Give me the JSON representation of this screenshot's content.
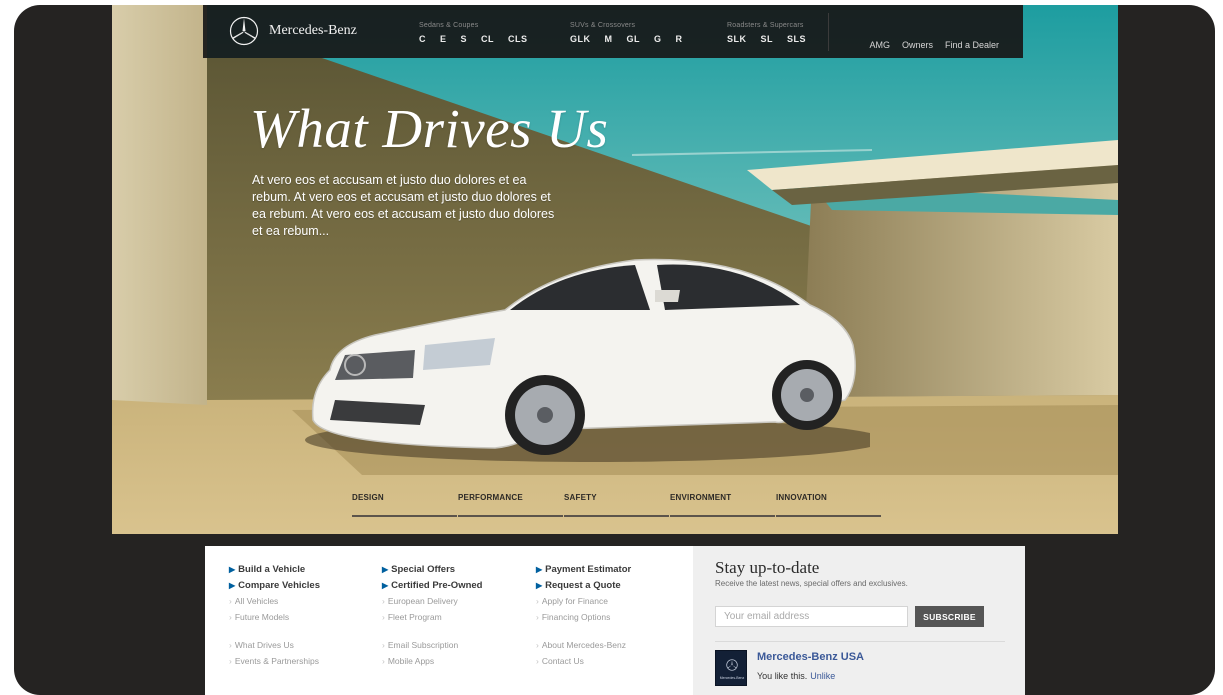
{
  "brand": {
    "name": "Mercedes-Benz"
  },
  "nav": {
    "groups": [
      {
        "caption": "Sedans & Coupes",
        "items": [
          "C",
          "E",
          "S",
          "CL",
          "CLS"
        ]
      },
      {
        "caption": "SUVs & Crossovers",
        "items": [
          "GLK",
          "M",
          "GL",
          "G",
          "R"
        ]
      },
      {
        "caption": "Roadsters & Supercars",
        "items": [
          "SLK",
          "SL",
          "SLS"
        ]
      }
    ],
    "links": [
      "AMG",
      "Owners",
      "Find a Dealer"
    ]
  },
  "hero": {
    "headline": "What Drives Us",
    "intro": "At vero eos et accusam et justo duo dolores et ea rebum. At vero eos et accusam et justo duo dolores et ea rebum. At vero eos et accusam et justo duo dolores et ea rebum...",
    "tabs": [
      "DESIGN",
      "PERFORMANCE",
      "SAFETY",
      "ENVIRONMENT",
      "INNOVATION"
    ]
  },
  "footer_links": {
    "col1": {
      "primary": [
        "Build a Vehicle",
        "Compare Vehicles"
      ],
      "secondary": [
        "All Vehicles",
        "Future Models"
      ],
      "tertiary": [
        "What Drives Us",
        "Events & Partnerships"
      ]
    },
    "col2": {
      "primary": [
        "Special Offers",
        "Certified Pre-Owned"
      ],
      "secondary": [
        "European Delivery",
        "Fleet Program"
      ],
      "tertiary": [
        "Email Subscription",
        "Mobile Apps"
      ]
    },
    "col3": {
      "primary": [
        "Payment Estimator",
        "Request a Quote"
      ],
      "secondary": [
        "Apply for Finance",
        "Financing Options"
      ],
      "tertiary": [
        "About Mercedes-Benz",
        "Contact Us"
      ]
    }
  },
  "newsletter": {
    "title": "Stay up-to-date",
    "subtitle": "Receive the latest news, special offers and exclusives.",
    "placeholder": "Your email address",
    "button": "SUBSCRIBE"
  },
  "facebook": {
    "page_name": "Mercedes-Benz USA",
    "thumb_label": "Mercedes-Benz",
    "like_text": "You like this.",
    "unlike": "Unlike"
  },
  "colors": {
    "accent_blue": "#00609f",
    "facebook_blue": "#3b5998",
    "nav_bg": "#181818",
    "subscribe_bg": "#555555"
  }
}
